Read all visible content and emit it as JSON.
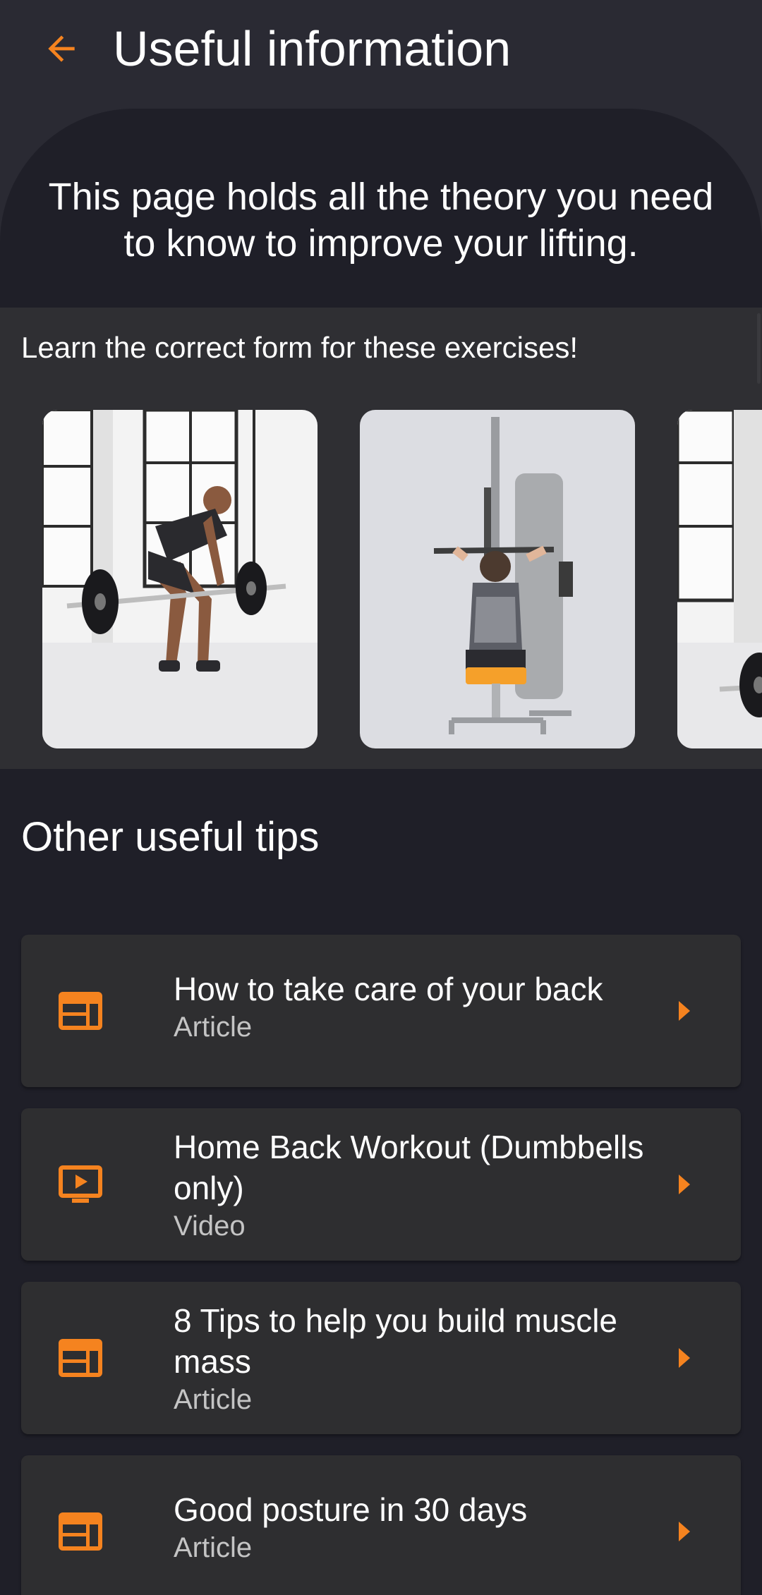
{
  "header": {
    "title": "Useful information",
    "back_icon": "arrow-back-icon"
  },
  "hero": {
    "text": "This page holds all the theory you need to know to improve your lifting."
  },
  "exercises": {
    "heading": "Learn the correct form for these exercises!",
    "cards": [
      {
        "image": "barbell-row-photo"
      },
      {
        "image": "lat-pulldown-photo"
      },
      {
        "image": "barbell-photo-partial"
      }
    ]
  },
  "tips": {
    "title": "Other useful tips",
    "items": [
      {
        "title": "How to take care of your back",
        "type": "Article",
        "icon": "article-icon"
      },
      {
        "title": "Home Back Workout (Dumbbells only)",
        "type": "Video",
        "icon": "video-icon"
      },
      {
        "title": "8 Tips to help you build muscle mass",
        "type": "Article",
        "icon": "article-icon"
      },
      {
        "title": "Good posture in 30 days",
        "type": "Article",
        "icon": "article-icon"
      }
    ]
  },
  "colors": {
    "accent": "#f5831f",
    "background": "#1f1f28",
    "card": "#2e2e30",
    "header": "#2a2a33"
  }
}
